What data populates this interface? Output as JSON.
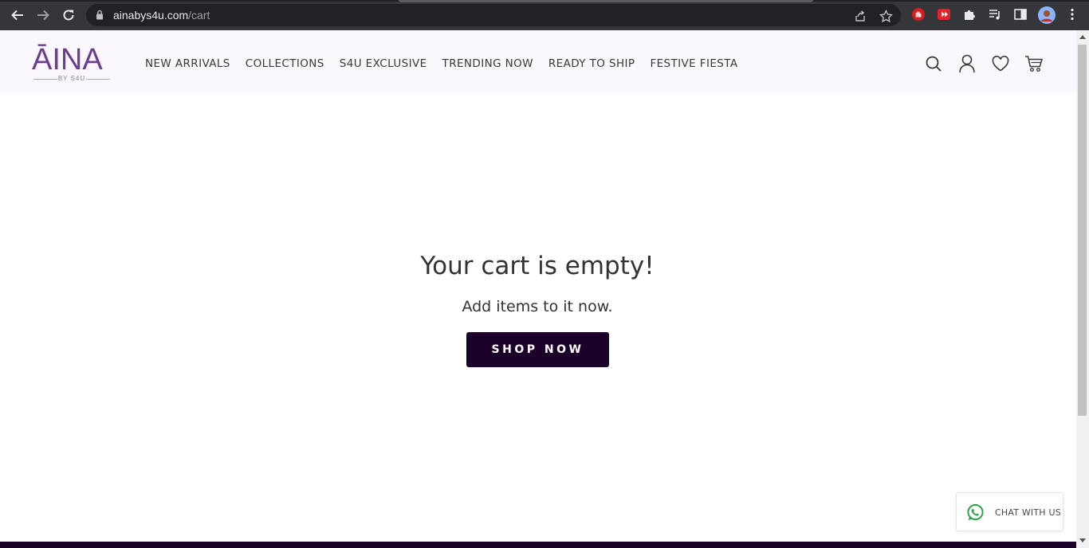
{
  "browser": {
    "url_host": "ainabys4u.com",
    "url_path": "/cart",
    "icons": {
      "back": "back-arrow-icon",
      "forward": "forward-arrow-icon",
      "reload": "reload-icon",
      "lock": "lock-icon",
      "share": "share-icon",
      "bookmark": "star-icon",
      "extensions": [
        "hand-extension-icon",
        "media-extension-icon",
        "puzzle-icon",
        "playlist-icon",
        "sidepanel-icon",
        "profile-avatar",
        "kebab-menu-icon"
      ]
    }
  },
  "site": {
    "logo_text": "ĀINA",
    "logo_sub": "BY S4U",
    "nav": [
      "NEW ARRIVALS",
      "COLLECTIONS",
      "S4U EXCLUSIVE",
      "TRENDING NOW",
      "READY TO SHIP",
      "FESTIVE FIESTA"
    ],
    "header_icons": [
      "search-icon",
      "account-icon",
      "wishlist-icon",
      "cart-icon"
    ]
  },
  "cart": {
    "title": "Your cart is empty!",
    "subtitle": "Add items to it now.",
    "cta": "SHOP NOW"
  },
  "chat_widget": {
    "label": "CHAT WITH US",
    "icon": "whatsapp-icon"
  },
  "colors": {
    "brand_purple": "#6b3e8e",
    "button_dark": "#1c0228",
    "header_bg": "#faf7fd",
    "whatsapp_green": "#25a244"
  }
}
